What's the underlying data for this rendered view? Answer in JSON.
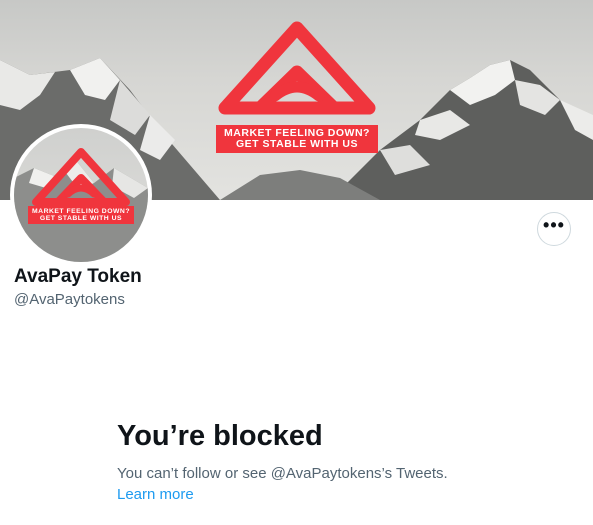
{
  "profile": {
    "display_name": "AvaPay Token",
    "handle": "@AvaPaytokens",
    "more_button": "•••",
    "banner_tagline": [
      "MARKET FEELING DOWN?",
      "GET STABLE WITH US"
    ],
    "avatar_tagline": [
      "MARKET FEELING DOWN?",
      "GET STABLE WITH US"
    ]
  },
  "blocked": {
    "title": "You’re blocked",
    "description": "You can’t follow or see @AvaPaytokens’s Tweets.",
    "learn_more": "Learn more"
  },
  "colors": {
    "brand_red": "#f0353d",
    "link_blue": "#1d9bf0",
    "muted_text": "#536471"
  },
  "icons": {
    "more": "more-horizontal-icon",
    "logo": "avapay-logo-icon"
  }
}
